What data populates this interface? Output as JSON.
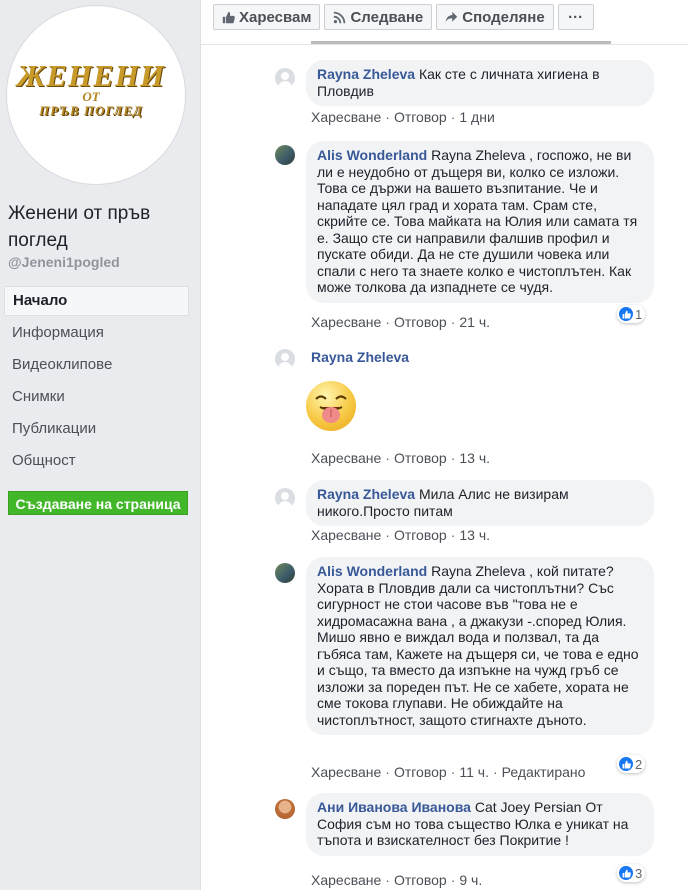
{
  "sidebar": {
    "logo": {
      "line1": "ЖЕНЕНИ",
      "line2": "ОТ",
      "line3": "ПРЪВ ПОГЛЕД"
    },
    "page_name": "Женени от пръв поглед",
    "handle": "@Jeneni1pogled",
    "nav": [
      {
        "label": "Начало",
        "active": true
      },
      {
        "label": "Информация"
      },
      {
        "label": "Видеоклипове"
      },
      {
        "label": "Снимки"
      },
      {
        "label": "Публикации"
      },
      {
        "label": "Общност"
      }
    ],
    "create_page": "Създаване на страница"
  },
  "actions": {
    "like": "Харесвам",
    "follow": "Следване",
    "share": "Споделяне",
    "more": "···"
  },
  "comments": [
    {
      "author": "Rayna Zheleva",
      "text": "Как сте с личната хигиена в Пловдив",
      "like": "Харесване",
      "reply": "Отговор",
      "time": "1 дни"
    },
    {
      "author": "Alis Wonderland",
      "text": "Rayna Zheleva , госпожо, не ви ли е неудобно от дъщеря ви, колко се изложи. Това се държи на вашето възпитание. Че и нападате цял град и хората там. Срам сте, скрийте се. Това майката на Юлия или самата тя е. Защо сте си направили фалшив профил и пускате обиди. Да не сте душили човека или спали с него та знаете колко е чистоплътен. Как може толкова да изпаднете се чудя.",
      "like": "Харесване",
      "reply": "Отговор",
      "time": "21 ч.",
      "reactions": "1"
    },
    {
      "author": "Rayna Zheleva",
      "sticker": "tongue-out-emoji",
      "like": "Харесване",
      "reply": "Отговор",
      "time": "13 ч."
    },
    {
      "author": "Rayna Zheleva",
      "text": "Мила Алис не визирам никого.Просто питам",
      "like": "Харесване",
      "reply": "Отговор",
      "time": "13 ч."
    },
    {
      "author": "Alis Wonderland",
      "text": "Rayna Zheleva , кой питате? Хората в Пловдив дали са чистоплътни? Със сигурност не стои часове във \"това не е хидромасажна вана , а джакузи -.според Юлия. Мишо явно е виждал вода и ползвал, та да гъбясa там, Кажете на дъщеря си, че това е едно и също, та вместо да изпъкне на чужд гръб се изложи за пореден път. Не се хабете, хората не сме токова глупави. Не обиждайте на чистоплътност, защото стигнахте дъното.",
      "like": "Харесване",
      "reply": "Отговор",
      "time": "11 ч.",
      "edited": "Редактирано",
      "reactions": "2"
    },
    {
      "author": "Ани Иванова Иванова",
      "text": "Cat Joey Persian От София съм но това същество Юлка е уникат на тъпота и взискателност без Покритие !",
      "like": "Харесване",
      "reply": "Отговор",
      "time": "9 ч.",
      "reactions": "3"
    }
  ],
  "colors": {
    "link": "#385898",
    "create_button": "#42b72a",
    "like_badge": "#1877f2"
  }
}
